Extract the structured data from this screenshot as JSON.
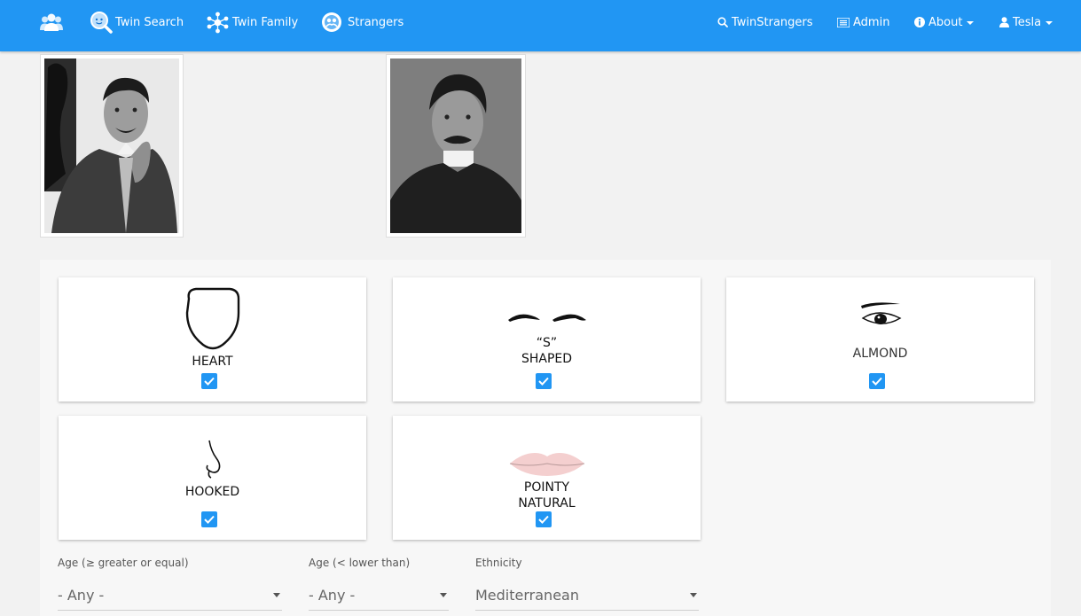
{
  "navbar": {
    "left_items": [
      {
        "label": "Twin Search",
        "icon": "magnifier-face-icon"
      },
      {
        "label": "Twin Family",
        "icon": "network-icon"
      },
      {
        "label": "Strangers",
        "icon": "faces-circle-icon"
      }
    ],
    "right_items": [
      {
        "label": "TwinStrangers",
        "icon": "search-icon"
      },
      {
        "label": "Admin",
        "icon": "list-icon"
      },
      {
        "label": "About",
        "icon": "info-icon"
      },
      {
        "label": "Tesla",
        "icon": "user-icon"
      }
    ],
    "brand_icon": "users-icon"
  },
  "features": [
    {
      "label_line1": "HEART",
      "label_line2": "",
      "checked": true,
      "icon": "heart-face-shape-icon"
    },
    {
      "label_line1": "“S”",
      "label_line2": "SHAPED",
      "checked": true,
      "icon": "s-shaped-eyebrows-icon"
    },
    {
      "label_line1": "ALMOND",
      "label_line2": "",
      "checked": true,
      "icon": "almond-eye-icon"
    },
    {
      "label_line1": "HOOKED",
      "label_line2": "",
      "checked": true,
      "icon": "hooked-nose-icon"
    },
    {
      "label_line1": "POINTY",
      "label_line2": "NATURAL",
      "checked": true,
      "icon": "pointy-natural-lips-icon"
    }
  ],
  "filters": {
    "age_min": {
      "label": "Age (≥ greater or equal)",
      "value": "- Any -"
    },
    "age_max": {
      "label": "Age (< lower than)",
      "value": "- Any -"
    },
    "ethnicity": {
      "label": "Ethnicity",
      "value": "Mediterranean"
    }
  },
  "colors": {
    "primary": "#2196f3",
    "background": "#f2f2f2"
  }
}
